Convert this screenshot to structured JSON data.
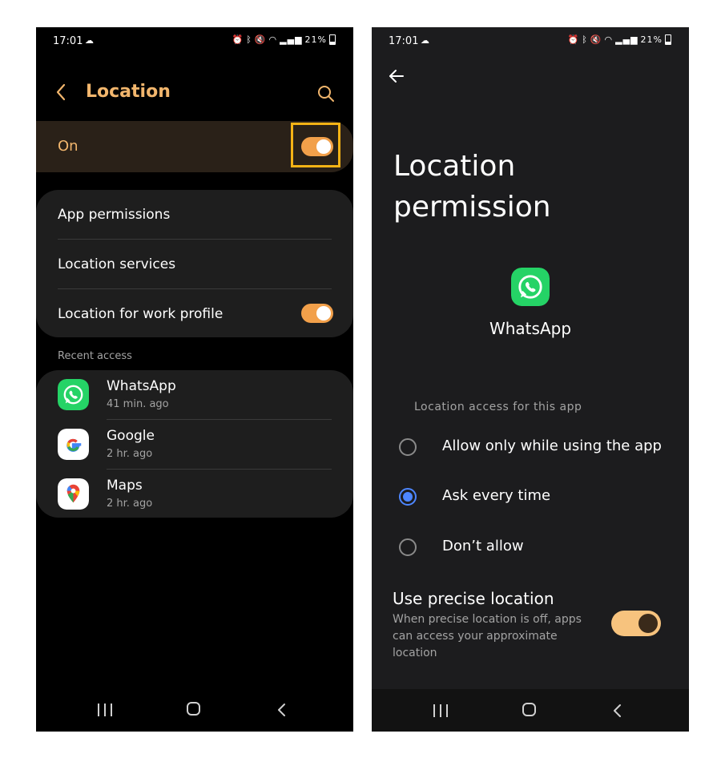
{
  "left": {
    "status": {
      "time": "17:01",
      "battery": "21%"
    },
    "header": {
      "title": "Location"
    },
    "master": {
      "label": "On",
      "enabled": true
    },
    "menu": {
      "app_permissions": "App permissions",
      "location_services": "Location services",
      "work_profile": "Location for work profile",
      "work_profile_enabled": true
    },
    "recent": {
      "label": "Recent access",
      "apps": [
        {
          "name": "WhatsApp",
          "time": "41 min. ago",
          "icon": "whatsapp-icon"
        },
        {
          "name": "Google",
          "time": "2 hr. ago",
          "icon": "google-icon"
        },
        {
          "name": "Maps",
          "time": "2 hr. ago",
          "icon": "maps-icon"
        }
      ]
    }
  },
  "right": {
    "status": {
      "time": "17:01",
      "battery": "21%"
    },
    "title": "Location permission",
    "app": {
      "name": "WhatsApp",
      "icon": "whatsapp-icon"
    },
    "access_label": "Location access for this app",
    "options": [
      {
        "label": "Allow only while using the app",
        "selected": false
      },
      {
        "label": "Ask every time",
        "selected": true
      },
      {
        "label": "Don’t allow",
        "selected": false
      }
    ],
    "precise": {
      "title": "Use precise location",
      "description": "When precise location is off, apps can access your approximate location",
      "enabled": true
    }
  },
  "colors": {
    "accent": "#f2b66d",
    "toggle": "#f2a04a",
    "highlight": "#f5b315",
    "radio_selected": "#4d86ff",
    "whatsapp_green": "#25d366"
  }
}
